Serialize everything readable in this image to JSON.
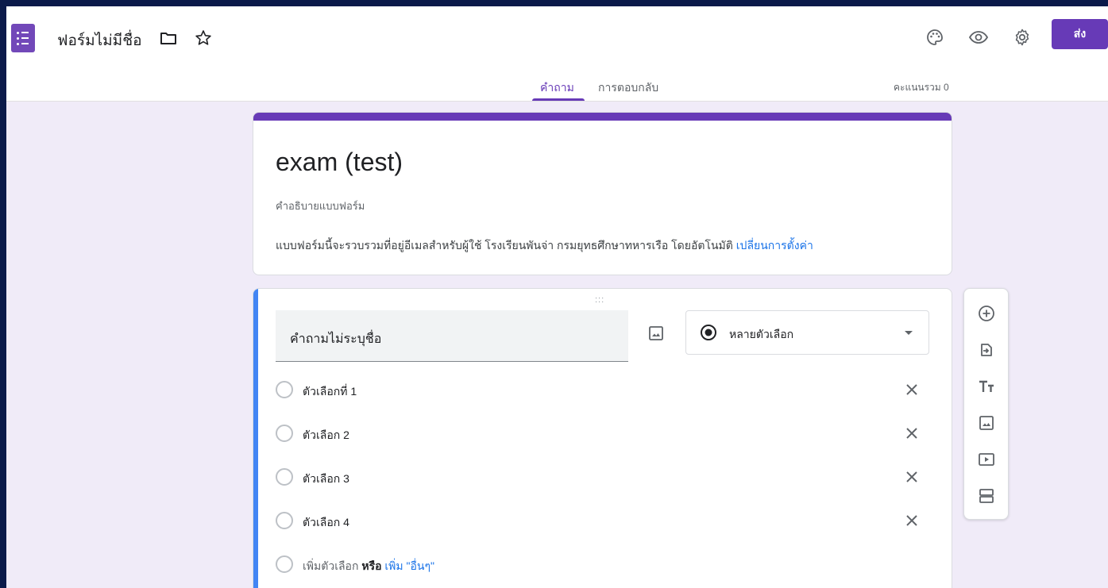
{
  "header": {
    "doc_title": "ฟอร์มไม่มีชื่อ",
    "send_label": "ส่ง",
    "tabs": [
      {
        "label": "คำถาม",
        "active": true
      },
      {
        "label": "การตอบกลับ",
        "active": false
      }
    ],
    "total_points": "คะแนนรวม 0",
    "icons": [
      "forms-logo-icon",
      "folder-icon",
      "star-icon",
      "palette-icon",
      "preview-eye-icon",
      "settings-gear-icon"
    ]
  },
  "form": {
    "title": "exam (test)",
    "description": "คำอธิบายแบบฟอร์ม",
    "email_note": "แบบฟอร์มนี้จะรวบรวมที่อยู่อีเมลสำหรับผู้ใช้ โรงเรียนพันจ่า กรมยุทธศึกษาทหารเรือ โดยอัตโนมัติ",
    "email_note_link": "เปลี่ยนการตั้งค่า"
  },
  "question": {
    "drag_handle": ":::",
    "title": "คำถามไม่ระบุชื่อ",
    "type_label": "หลายตัวเลือก",
    "options": [
      {
        "label": "ตัวเลือกที่ 1"
      },
      {
        "label": "ตัวเลือก 2"
      },
      {
        "label": "ตัวเลือก 3"
      },
      {
        "label": "ตัวเลือก 4"
      }
    ],
    "add_option": "เพิ่มตัวเลือก",
    "or_text": "หรือ",
    "add_other": "เพิ่ม \"อื่นๆ\""
  },
  "toolbar": {
    "items": [
      "add-question-icon",
      "import-questions-icon",
      "add-title-text-icon",
      "add-image-icon",
      "add-video-icon",
      "add-section-icon"
    ]
  },
  "colors": {
    "accent": "#673ab7",
    "background": "#f0ebf8",
    "question_accent": "#4285f4",
    "link": "#1a73e8"
  }
}
